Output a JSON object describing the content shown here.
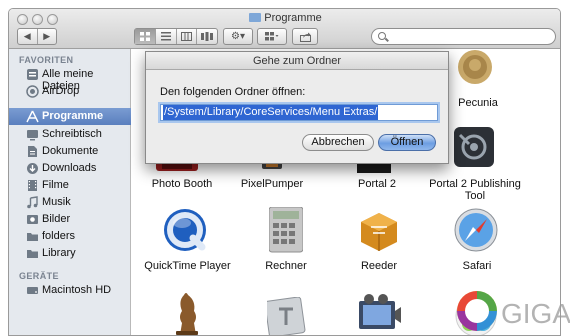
{
  "window": {
    "title": "Programme",
    "toolbar": {
      "view_modes": [
        "icon-view",
        "list-view",
        "column-view",
        "cover-flow-view"
      ],
      "active_view": "icon-view",
      "icons": [
        "chevron-left-icon",
        "chevron-right-icon",
        "gear-icon",
        "arrange-icon",
        "share-icon"
      ]
    }
  },
  "sidebar": {
    "favorites_header": "FAVORITEN",
    "devices_header": "GERÄTE",
    "items": [
      {
        "label": "Alle meine Dateien",
        "icon": "all-files-icon",
        "selected": false
      },
      {
        "label": "AirDrop",
        "icon": "airdrop-icon",
        "selected": false
      },
      {
        "label": "Programme",
        "icon": "applications-icon",
        "selected": true
      },
      {
        "label": "Schreibtisch",
        "icon": "desktop-icon",
        "selected": false
      },
      {
        "label": "Dokumente",
        "icon": "documents-icon",
        "selected": false
      },
      {
        "label": "Downloads",
        "icon": "downloads-icon",
        "selected": false
      },
      {
        "label": "Filme",
        "icon": "movies-icon",
        "selected": false
      },
      {
        "label": "Musik",
        "icon": "music-icon",
        "selected": false
      },
      {
        "label": "Bilder",
        "icon": "pictures-icon",
        "selected": false
      },
      {
        "label": "folders",
        "icon": "folder-icon",
        "selected": false
      },
      {
        "label": "Library",
        "icon": "folder-icon",
        "selected": false
      }
    ],
    "devices": [
      {
        "label": "Macintosh HD",
        "icon": "hard-drive-icon"
      }
    ]
  },
  "apps": [
    {
      "label": "Photo Booth",
      "icon": "photo-booth-icon"
    },
    {
      "label": "PixelPumper",
      "icon": "pixelpumper-icon"
    },
    {
      "label": "Portal 2",
      "icon": "portal-2-icon"
    },
    {
      "label": "Portal 2 Publishing Tool",
      "icon": "portal-2-publishing-tool-icon"
    },
    {
      "label": "Pecunia",
      "icon": "pecunia-icon"
    },
    {
      "label": "QuickTime Player",
      "icon": "quicktime-icon"
    },
    {
      "label": "Rechner",
      "icon": "calculator-icon"
    },
    {
      "label": "Reeder",
      "icon": "reeder-icon"
    },
    {
      "label": "Safari",
      "icon": "safari-icon"
    },
    {
      "label": "",
      "icon": "chess-icon"
    },
    {
      "label": "",
      "icon": "script-editor-icon"
    },
    {
      "label": "",
      "icon": "screen-recording-icon"
    },
    {
      "label": "",
      "icon": "game-center-icon"
    }
  ],
  "dialog": {
    "title": "Gehe zum Ordner",
    "prompt": "Den folgenden Ordner öffnen:",
    "path_value": "/System/Library/CoreServices/Menu Extras/",
    "cancel_label": "Abbrechen",
    "open_label": "Öffnen"
  },
  "watermark": {
    "text": "GIGA",
    "colors": [
      "#e53935",
      "#fdd835",
      "#43a047",
      "#1e88e5",
      "#8e24aa"
    ]
  },
  "colors": {
    "selection": "#5a7fbe",
    "default_button": "#6d9ee2",
    "text_selection": "#2f66d2"
  }
}
